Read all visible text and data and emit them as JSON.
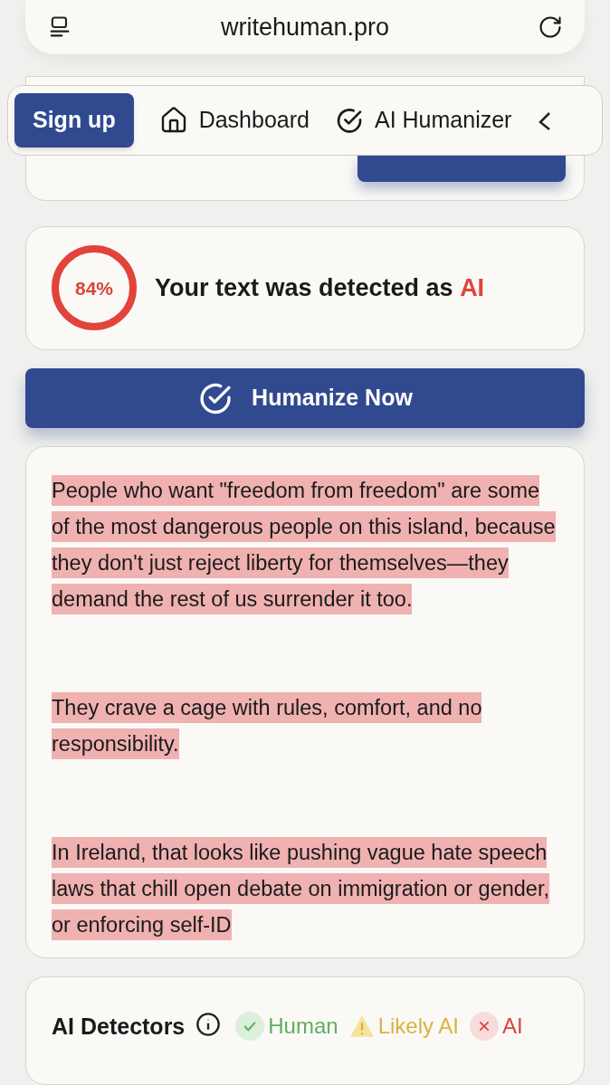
{
  "address_bar": {
    "url": "writehuman.pro"
  },
  "nav": {
    "signup": "Sign up",
    "items": [
      {
        "label": "Dashboard",
        "kind": "home"
      },
      {
        "label": "AI Humanizer",
        "kind": "check"
      }
    ]
  },
  "result": {
    "score": "84%",
    "message": "Your text was detected as **AI**"
  },
  "humanize_button": "Humanize Now",
  "text_paragraphs": [
    "People who want \"freedom from freedom\" are some of the most dangerous people on this island, because they don't just reject liberty for themselves—they demand the rest of us surrender it too.",
    "They crave a cage with rules, comfort, and no responsibility.",
    "In Ireland, that looks like pushing vague hate speech laws that chill open debate on immigration or gender, or enforcing self-ID"
  ],
  "detectors": {
    "title": "AI Detectors",
    "legend": [
      {
        "label": "Human",
        "kind": "human",
        "color": "#5fae5f"
      },
      {
        "label": "Likely AI",
        "kind": "likely",
        "color": "#d9b33f"
      },
      {
        "label": "AI",
        "kind": "ai",
        "color": "#d9443c"
      }
    ]
  }
}
